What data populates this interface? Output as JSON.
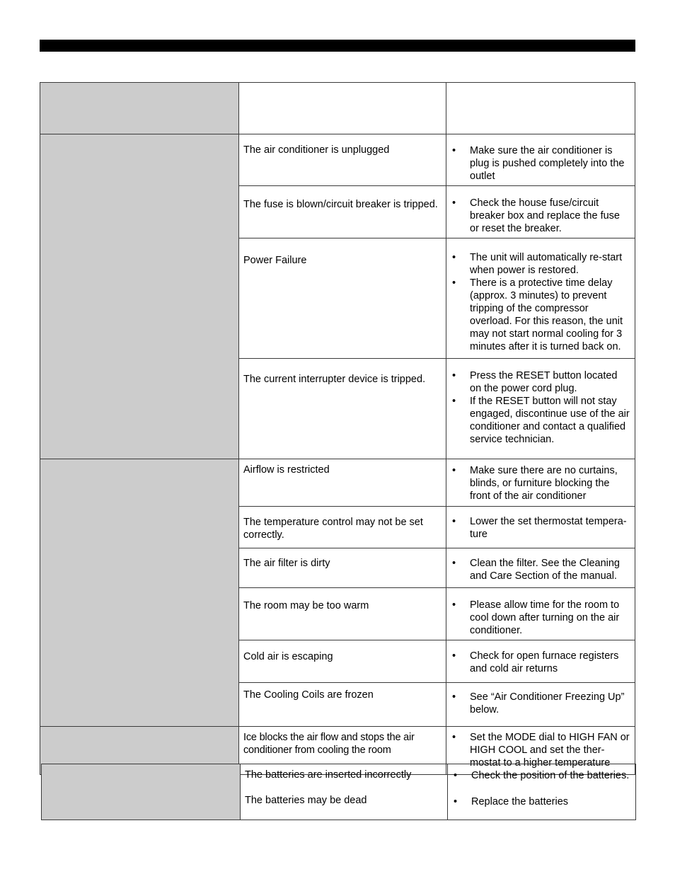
{
  "header": {
    "problem_label": "",
    "cause_label": "",
    "solution_label": ""
  },
  "sections": [
    {
      "category": "",
      "rows": [
        {
          "cause": "The air conditioner is unplugged",
          "solutions": [
            "Make sure the air conditioner is plug is pushed completely into the outlet"
          ]
        },
        {
          "cause": "The fuse is blown/circuit breaker is tripped.",
          "solutions": [
            "Check the house fuse/circuit breaker box and replace the fuse or reset the breaker."
          ]
        },
        {
          "cause": "Power Failure",
          "solutions": [
            "The unit will automatically re-start when power is restored.",
            "There is a protective time delay (approx. 3 minutes) to prevent tripping of the compressor overload. For this reason, the unit may not start normal cooling for 3 minutes after it is turned back on."
          ]
        },
        {
          "cause": "The current interrupter device is tripped.",
          "solutions": [
            "Press the RESET button located on the power cord plug.",
            "If the RESET button will not stay engaged, discontinue use of the air conditioner and contact a qualified service technician."
          ]
        }
      ]
    },
    {
      "category": "",
      "rows": [
        {
          "cause": "Airflow is restricted",
          "solutions": [
            "Make sure there are no curtains, blinds, or furniture blocking the front of the air conditioner"
          ]
        },
        {
          "cause": "The temperature control may not be set correctly.",
          "solutions": [
            "Lower the set thermostat tempera-ture"
          ]
        },
        {
          "cause": "The air filter is dirty",
          "solutions": [
            "Clean the filter. See the Cleaning and Care Section of the manual."
          ]
        },
        {
          "cause": "The room may be too warm",
          "solutions": [
            "Please allow time for the room to cool down after turning on the air conditioner."
          ]
        },
        {
          "cause": "Cold air is escaping",
          "solutions": [
            "Check for open furnace registers and cold air returns"
          ]
        },
        {
          "cause": "The Cooling Coils are frozen",
          "solutions": [
            "See “Air Conditioner Freezing Up” below."
          ]
        }
      ]
    },
    {
      "category": "",
      "rows": [
        {
          "cause": "Ice blocks the air flow and stops the air conditioner from cooling the room",
          "solutions": [
            "Set the MODE dial to HIGH FAN or HIGH COOL and set the ther-mostat to a higher temperature"
          ]
        }
      ]
    },
    {
      "category": "",
      "rows": [
        {
          "cause": "The batteries are inserted incorrectly",
          "solutions": [
            "Check the position of the batteries."
          ]
        },
        {
          "cause": "The batteries may be dead",
          "solutions": [
            "Replace the batteries"
          ]
        }
      ]
    }
  ]
}
